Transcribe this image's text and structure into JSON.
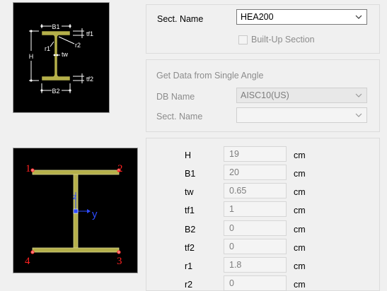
{
  "section_name": {
    "label": "Sect. Name",
    "value": "HEA200",
    "builtup_label": "Built-Up Section"
  },
  "single_angle": {
    "title": "Get Data from Single Angle",
    "db_label": "DB Name",
    "db_value": "AISC10(US)",
    "sect_label": "Sect. Name",
    "sect_value": ""
  },
  "diagram_dims": {
    "b1": "B1",
    "b2": "B2",
    "h": "H",
    "tf1": "tf1",
    "tf2": "tf2",
    "r1": "r1",
    "r2": "r2",
    "tw": "tw"
  },
  "preview": {
    "points": [
      "1",
      "2",
      "3",
      "4"
    ],
    "axis_y": "y",
    "axis_z": "z"
  },
  "properties": [
    {
      "name": "H",
      "value": "19",
      "unit": "cm"
    },
    {
      "name": "B1",
      "value": "20",
      "unit": "cm"
    },
    {
      "name": "tw",
      "value": "0.65",
      "unit": "cm"
    },
    {
      "name": "tf1",
      "value": "1",
      "unit": "cm"
    },
    {
      "name": "B2",
      "value": "0",
      "unit": "cm"
    },
    {
      "name": "tf2",
      "value": "0",
      "unit": "cm"
    },
    {
      "name": "r1",
      "value": "1.8",
      "unit": "cm"
    },
    {
      "name": "r2",
      "value": "0",
      "unit": "cm"
    }
  ],
  "colors": {
    "flange": "#b5b04a",
    "dim_lines": "#ffffff",
    "point_label": "#ff2020",
    "axis": "#2d4bff"
  }
}
